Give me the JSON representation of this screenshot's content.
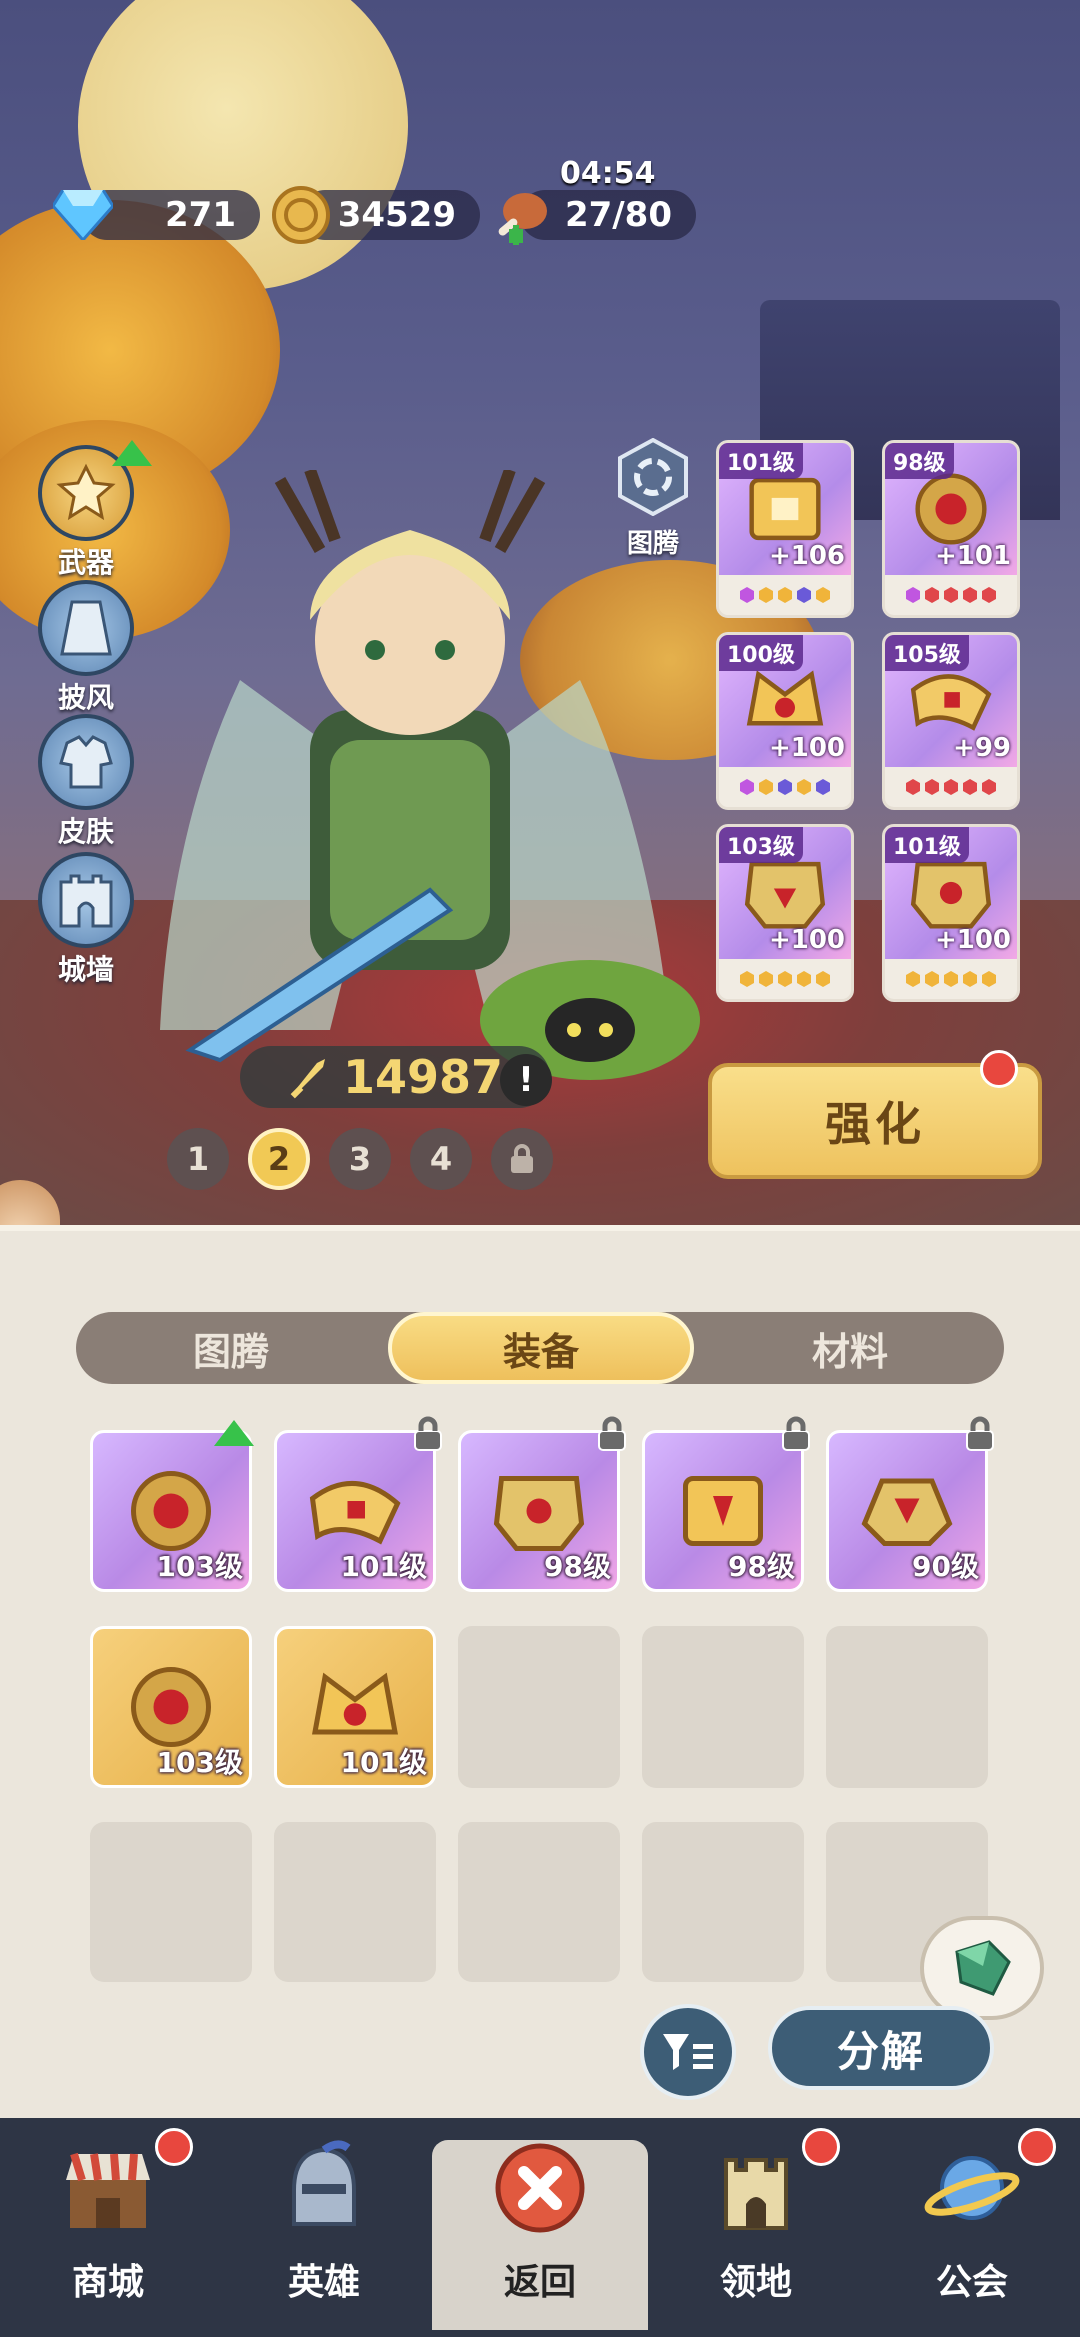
{
  "resources": {
    "gems": "271",
    "coins": "34529",
    "stamina": "27/80",
    "timer": "04:54"
  },
  "side_menu": [
    {
      "label": "武器",
      "icon": "weapon-icon"
    },
    {
      "label": "披风",
      "icon": "cape-icon"
    },
    {
      "label": "皮肤",
      "icon": "skin-icon"
    },
    {
      "label": "城墙",
      "icon": "wall-icon"
    }
  ],
  "totem_label": "图腾",
  "equipped": [
    {
      "level": "101级",
      "plus": "+106",
      "gems": [
        "#c056e0",
        "#f0b43a",
        "#f0b43a",
        "#6a5ad8",
        "#f0b43a"
      ]
    },
    {
      "level": "98级",
      "plus": "+101",
      "gems": [
        "#c056e0",
        "#e0464a",
        "#e0464a",
        "#e0464a",
        "#e0464a"
      ]
    },
    {
      "level": "100级",
      "plus": "+100",
      "gems": [
        "#c056e0",
        "#f0b43a",
        "#6a5ad8",
        "#f0b43a",
        "#6a5ad8"
      ]
    },
    {
      "level": "105级",
      "plus": "+99",
      "gems": [
        "#e0464a",
        "#e0464a",
        "#e0464a",
        "#e0464a",
        "#e0464a"
      ]
    },
    {
      "level": "103级",
      "plus": "+100",
      "gems": [
        "#f0b43a",
        "#f0b43a",
        "#f0b43a",
        "#f0b43a",
        "#f0b43a"
      ]
    },
    {
      "level": "101级",
      "plus": "+100",
      "gems": [
        "#f0b43a",
        "#f0b43a",
        "#f0b43a",
        "#f0b43a",
        "#f0b43a"
      ]
    }
  ],
  "power": "14987",
  "pages": [
    "1",
    "2",
    "3",
    "4"
  ],
  "active_page": "2",
  "enhance_label": "强化",
  "tabs": [
    "图腾",
    "装备",
    "材料"
  ],
  "active_tab": "装备",
  "inventory_row1": [
    {
      "level": "103级",
      "locked": false
    },
    {
      "level": "101级",
      "locked": true
    },
    {
      "level": "98级",
      "locked": true
    },
    {
      "level": "98级",
      "locked": true
    },
    {
      "level": "90级",
      "locked": true
    }
  ],
  "inventory_row2": [
    {
      "level": "103级"
    },
    {
      "level": "101级"
    }
  ],
  "decompose_label": "分解",
  "nav": [
    {
      "label": "商城",
      "icon": "shop-icon"
    },
    {
      "label": "英雄",
      "icon": "hero-helmet-icon"
    },
    {
      "label": "返回",
      "icon": "close-icon"
    },
    {
      "label": "领地",
      "icon": "castle-icon"
    },
    {
      "label": "公会",
      "icon": "planet-icon"
    }
  ],
  "colors": {
    "accent_gold": "#eec25e",
    "epic_purple": "#b98ae6",
    "nav_bg": "#2e3545",
    "badge_red": "#e8473e"
  }
}
